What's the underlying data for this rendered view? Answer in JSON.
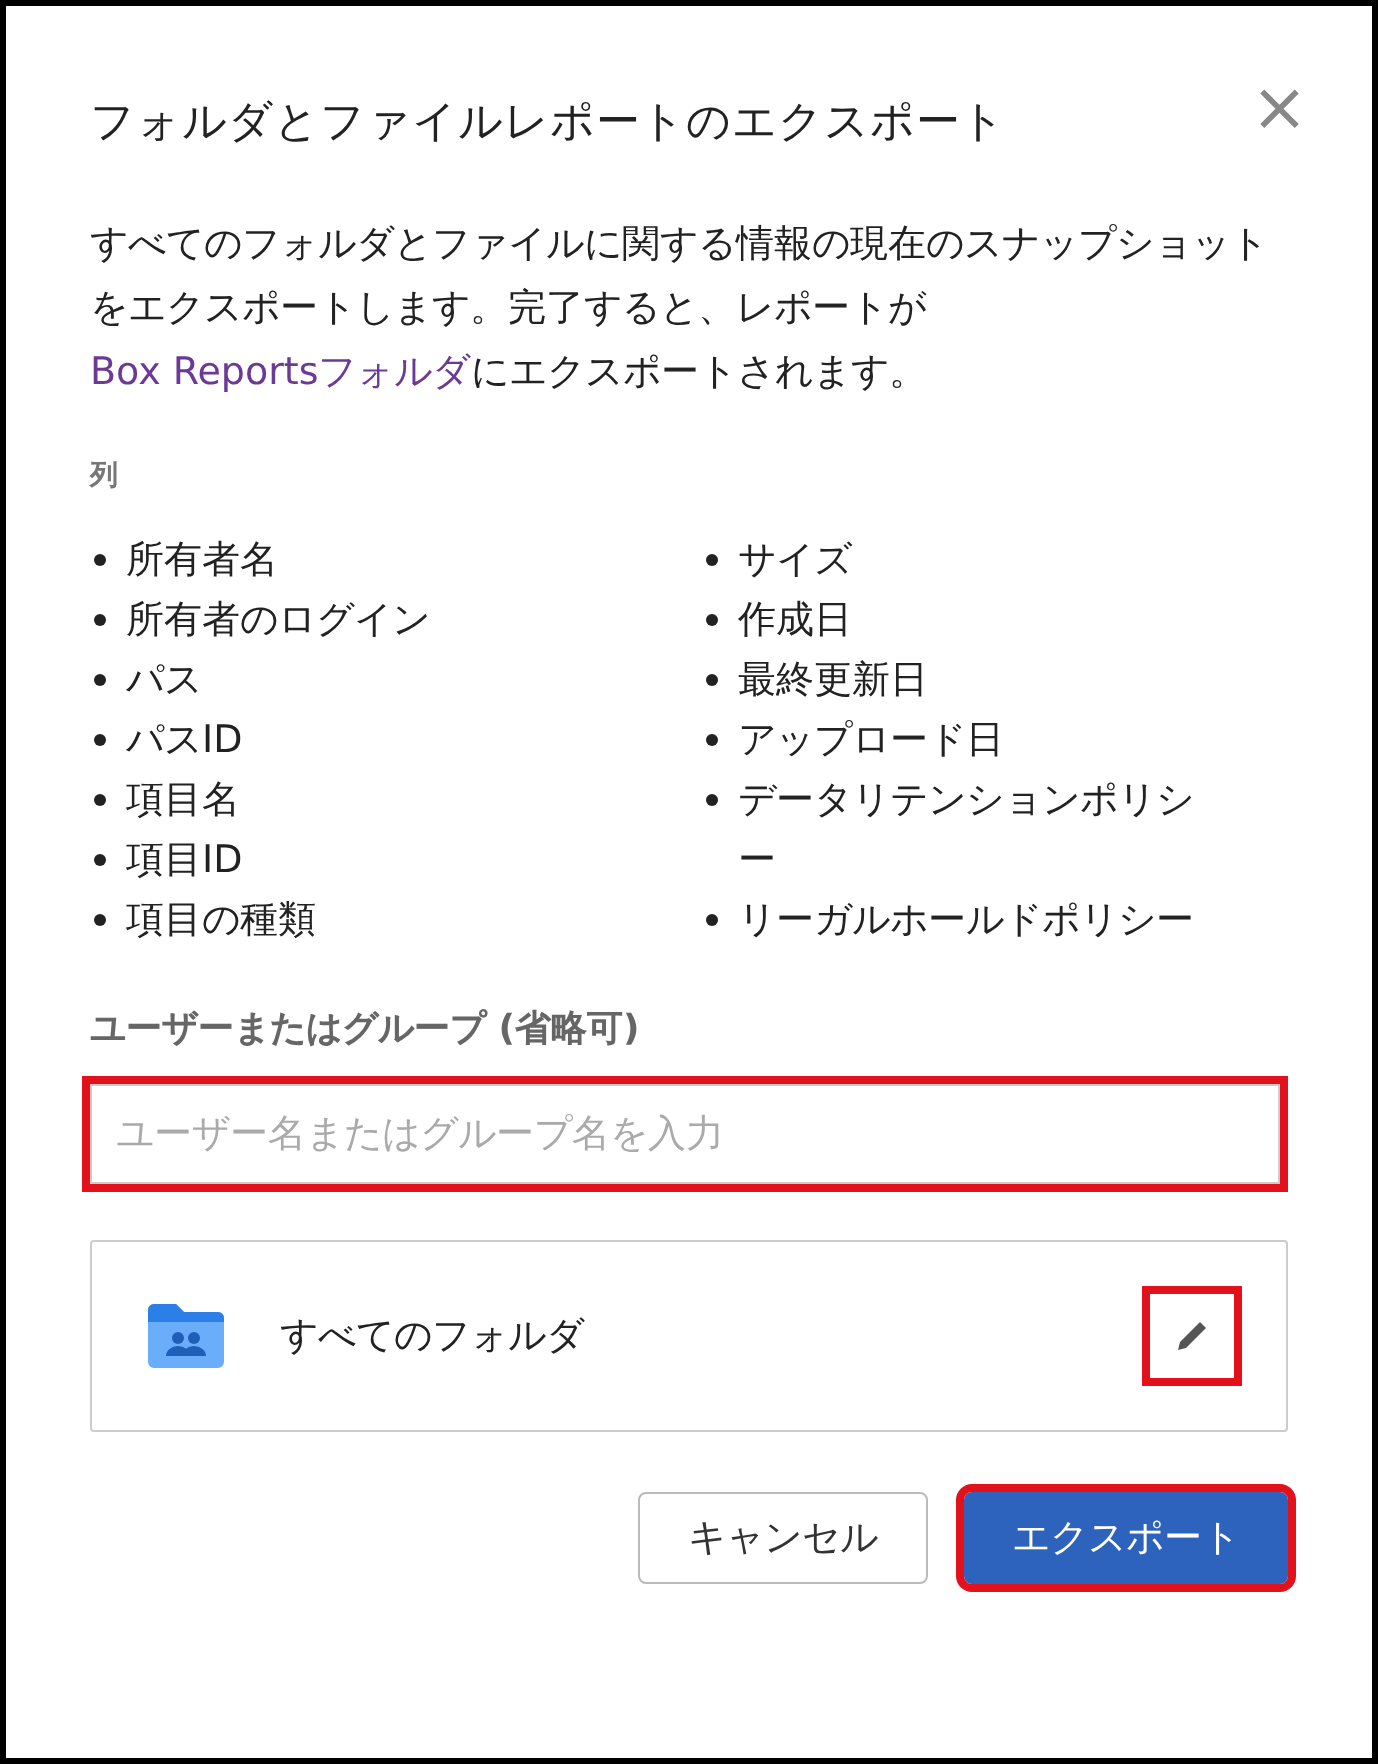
{
  "dialog": {
    "title": "フォルダとファイルレポートのエクスポート",
    "close": "×",
    "description": {
      "before": "すべてのフォルダとファイルに関する情報の現在のスナップショットをエクスポートします。完了すると、レポートが",
      "link": "Box Reportsフォルダ",
      "after": "にエクスポートされます。"
    },
    "columns_label": "列",
    "columns_left": [
      "所有者名",
      "所有者のログイン",
      "パス",
      "パスID",
      "項目名",
      "項目ID",
      "項目の種類"
    ],
    "columns_right": [
      "サイズ",
      "作成日",
      "最終更新日",
      "アップロード日",
      "データリテンションポリシー",
      "リーガルホールドポリシー"
    ],
    "user_field": {
      "label": "ユーザーまたはグループ (省略可)",
      "placeholder": "ユーザー名またはグループ名を入力",
      "highlighted": true
    },
    "folder": {
      "name": "すべてのフォルダ",
      "edit_highlighted": true
    },
    "buttons": [
      {
        "label": "キャンセル",
        "kind": "secondary",
        "highlighted": false
      },
      {
        "label": "エクスポート",
        "kind": "primary",
        "highlighted": true
      }
    ]
  }
}
